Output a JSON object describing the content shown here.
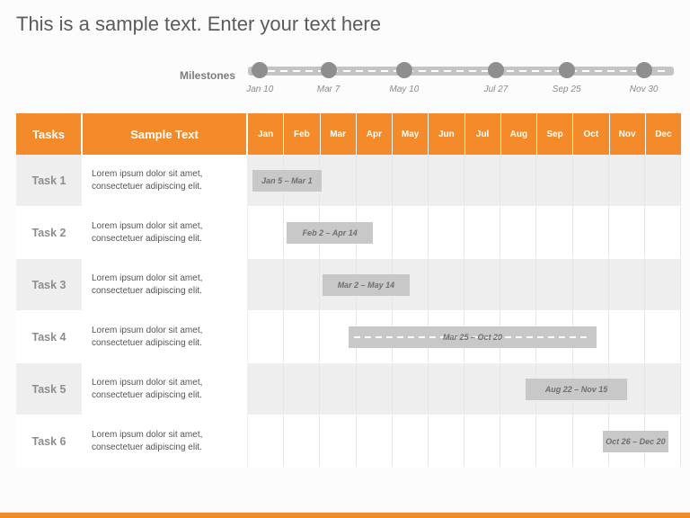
{
  "title": "This is a sample text. Enter your text here",
  "milestones": {
    "label": "Milestones",
    "items": [
      {
        "label": "Jan 10",
        "month_pos": 0.33
      },
      {
        "label": "Mar 7",
        "month_pos": 2.23
      },
      {
        "label": "May 10",
        "month_pos": 4.33
      },
      {
        "label": "Jul 27",
        "month_pos": 6.87
      },
      {
        "label": "Sep 25",
        "month_pos": 8.83
      },
      {
        "label": "Nov 30",
        "month_pos": 10.97
      }
    ]
  },
  "headers": {
    "tasks": "Tasks",
    "sample": "Sample Text"
  },
  "months": [
    "Jan",
    "Feb",
    "Mar",
    "Apr",
    "May",
    "Jun",
    "Jul",
    "Aug",
    "Sep",
    "Oct",
    "Nov",
    "Dec"
  ],
  "rows": [
    {
      "task": "Task 1",
      "desc": "Lorem ipsum dolor sit amet, consectetuer adipiscing elit.",
      "bar": {
        "label": "Jan 5 – Mar 1",
        "start": 0.13,
        "end": 2.03,
        "long": false
      }
    },
    {
      "task": "Task 2",
      "desc": "Lorem ipsum dolor sit amet, consectetuer adipiscing elit.",
      "bar": {
        "label": "Feb 2 – Apr 14",
        "start": 1.07,
        "end": 3.47,
        "long": false
      }
    },
    {
      "task": "Task 3",
      "desc": "Lorem ipsum dolor sit amet, consectetuer adipiscing elit.",
      "bar": {
        "label": "Mar 2 – May 14",
        "start": 2.07,
        "end": 4.47,
        "long": false
      }
    },
    {
      "task": "Task 4",
      "desc": "Lorem ipsum dolor sit amet, consectetuer adipiscing elit.",
      "bar": {
        "label": "Mar 25 – Oct 20",
        "start": 2.8,
        "end": 9.65,
        "long": true
      }
    },
    {
      "task": "Task 5",
      "desc": "Lorem ipsum dolor sit amet, consectetuer adipiscing elit.",
      "bar": {
        "label": "Aug 22 – Nov 15",
        "start": 7.7,
        "end": 10.5,
        "long": false
      }
    },
    {
      "task": "Task 6",
      "desc": "Lorem ipsum dolor sit amet, consectetuer adipiscing elit.",
      "bar": {
        "label": "Oct 26 – Dec 20",
        "start": 9.83,
        "end": 11.65,
        "long": false
      }
    }
  ],
  "chart_data": {
    "type": "gantt",
    "title": "This is a sample text. Enter your text here",
    "x_categories": [
      "Jan",
      "Feb",
      "Mar",
      "Apr",
      "May",
      "Jun",
      "Jul",
      "Aug",
      "Sep",
      "Oct",
      "Nov",
      "Dec"
    ],
    "milestones": [
      "Jan 10",
      "Mar 7",
      "May 10",
      "Jul 27",
      "Sep 25",
      "Nov 30"
    ],
    "tasks": [
      {
        "name": "Task 1",
        "start": "Jan 5",
        "end": "Mar 1"
      },
      {
        "name": "Task 2",
        "start": "Feb 2",
        "end": "Apr 14"
      },
      {
        "name": "Task 3",
        "start": "Mar 2",
        "end": "May 14"
      },
      {
        "name": "Task 4",
        "start": "Mar 25",
        "end": "Oct 20"
      },
      {
        "name": "Task 5",
        "start": "Aug 22",
        "end": "Nov 15"
      },
      {
        "name": "Task 6",
        "start": "Oct 26",
        "end": "Dec 20"
      }
    ]
  }
}
